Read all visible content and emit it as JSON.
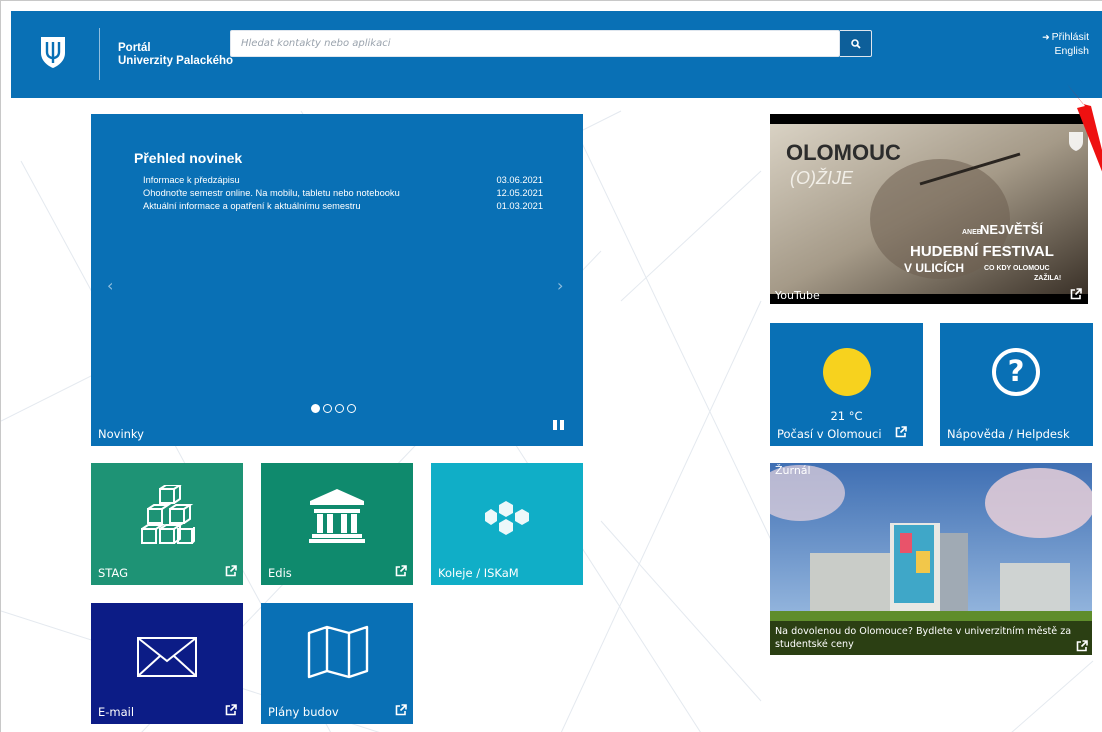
{
  "header": {
    "portal_line1": "Portál",
    "portal_line2": "Univerzity Palackého",
    "search_placeholder": "Hledat kontakty nebo aplikaci",
    "login_label": "Přihlásit",
    "language_label": "English"
  },
  "news": {
    "heading": "Přehled novinek",
    "items": [
      {
        "title": "Informace k předzápisu",
        "date": "03.06.2021"
      },
      {
        "title": "Ohodnoťte semestr online. Na mobilu, tabletu nebo notebooku",
        "date": "12.05.2021"
      },
      {
        "title": "Aktuální informace a opatření k aktuálnímu semestru",
        "date": "01.03.2021"
      }
    ],
    "prev_arrow": "‹",
    "next_arrow": "›",
    "tile_label": "Novinky"
  },
  "tiles": {
    "stag": "STAG",
    "edis": "Edis",
    "koleje": "Koleje / ISKaM",
    "email": "E-mail",
    "plany": "Plány budov",
    "youtube": "YouTube",
    "weather_temp": "21 °C",
    "weather_label": "Počasí v Olomouci",
    "helpdesk": "Nápověda / Helpdesk",
    "zurnal_tag": "Žurnál",
    "zurnal_caption": "Na dovolenou do Olomouce? Bydlete v univerzitním městě za studentské ceny"
  },
  "video_art_text": {
    "line1": "OLOMOUC",
    "line2": "(O)ŽIJE",
    "line3": "ANEB",
    "line4": "NEJVĚTŠÍ",
    "line5": "HUDEBNÍ FESTIVAL",
    "line6": "V ULICÍCH",
    "line7": "CO KDY OLOMOUC",
    "line8": "ZAŽILA!"
  },
  "colors": {
    "header_blue": "#0970b5",
    "stag_green": "#1e9375",
    "edis_green": "#0f8a6d",
    "koleje_cyan": "#10aec7",
    "email_navy": "#0c1c86",
    "sun_yellow": "#f7d21e"
  },
  "icons": [
    "up-logo-icon",
    "search-icon",
    "login-icon",
    "external-link-icon",
    "cubes-icon",
    "museum-icon",
    "hexagons-icon",
    "envelope-icon",
    "map-icon",
    "sun-icon",
    "question-icon",
    "pause-icon"
  ]
}
